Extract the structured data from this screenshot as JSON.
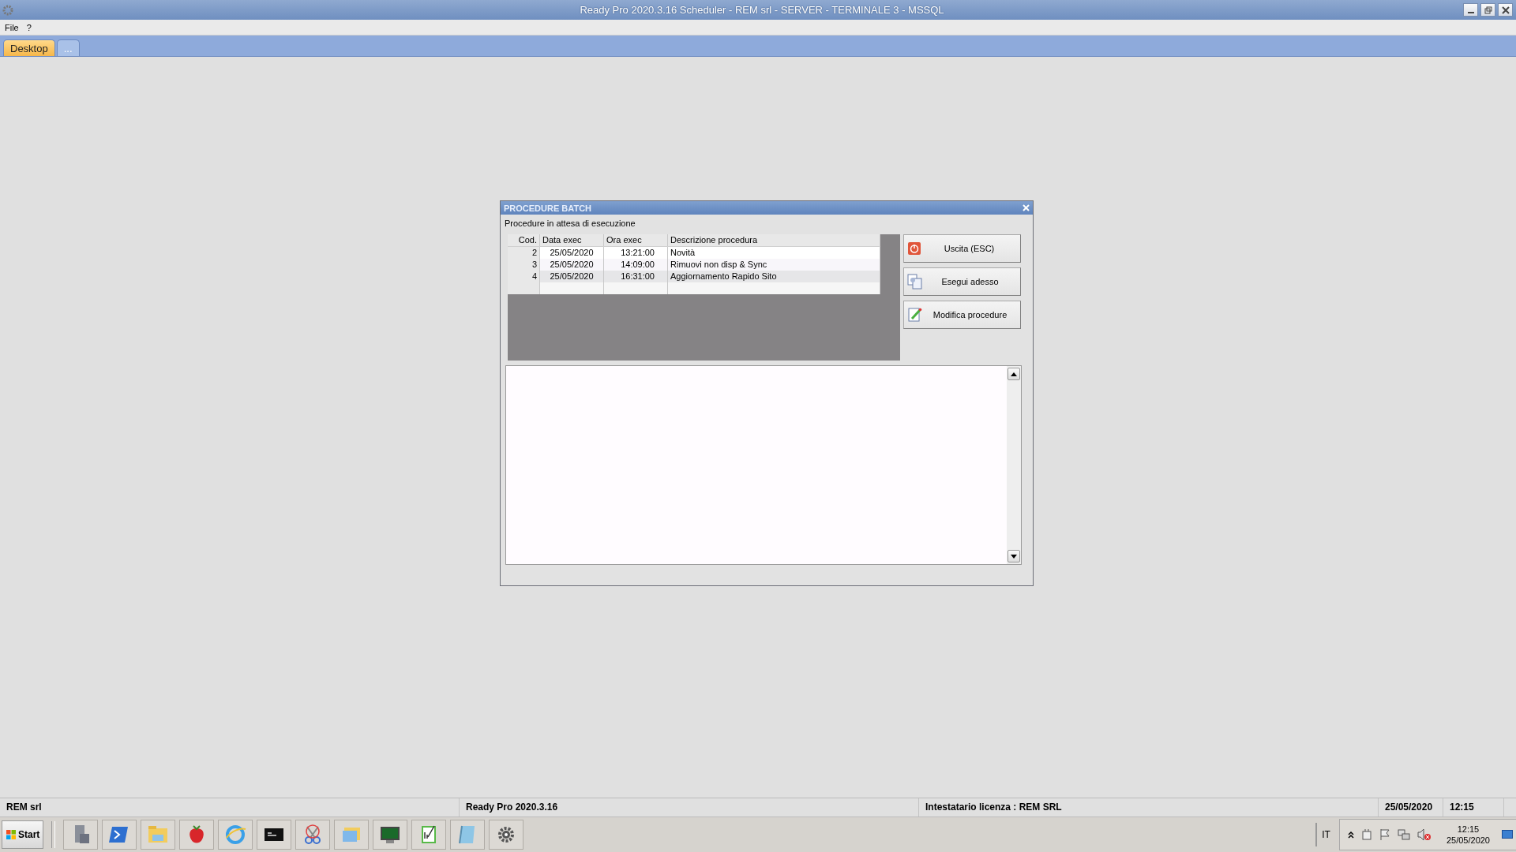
{
  "window": {
    "title": "Ready Pro 2020.3.16 Scheduler  - REM srl - SERVER - TERMINALE 3 - MSSQL"
  },
  "menu": [
    "File",
    "?"
  ],
  "tabs": [
    {
      "label": "Desktop",
      "selected": true
    },
    {
      "label": "...",
      "selected": false
    }
  ],
  "dialog": {
    "title": "PROCEDURE BATCH",
    "caption": "Procedure in attesa di esecuzione",
    "table": {
      "columns": [
        "Cod.",
        "Data exec",
        "Ora exec",
        "Descrizione procedura"
      ],
      "rows": [
        {
          "cells": [
            "2",
            "25/05/2020",
            "13:21:00",
            "Novità"
          ],
          "selected": false
        },
        {
          "cells": [
            "3",
            "25/05/2020",
            "14:09:00",
            "Rimuovi non disp & Sync"
          ],
          "selected": false
        },
        {
          "cells": [
            "4",
            "25/05/2020",
            "16:31:00",
            "Aggiornamento Rapido Sito"
          ],
          "selected": true
        }
      ]
    },
    "buttons": [
      "Uscita (ESC)",
      "Esegui adesso",
      "Modifica procedure"
    ]
  },
  "status_bar": [
    "REM srl",
    "Ready Pro 2020.3.16",
    "Intestatario licenza : REM SRL",
    "25/05/2020",
    "12:15"
  ],
  "taskbar": {
    "start": "Start",
    "language": "IT",
    "clock_time": "12:15",
    "clock_date": "25/05/2020"
  }
}
